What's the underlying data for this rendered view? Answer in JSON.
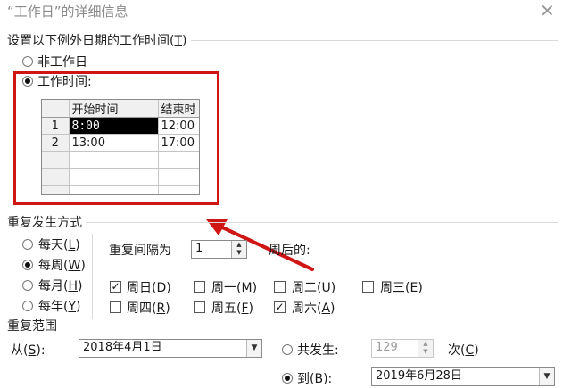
{
  "window": {
    "title": "“工作日”的详细信息",
    "close_label": "✕"
  },
  "worktime_section": {
    "label": "设置以下例外日期的工作时间(",
    "label_key": "T",
    "label_end": ")",
    "nonworking_label": "非工作日",
    "working_label": "工作时间:",
    "nonworking_selected": false,
    "working_selected": true
  },
  "time_grid": {
    "columns": [
      "开始时间",
      "结束时"
    ],
    "rows": [
      {
        "num": "1",
        "start": "8:00",
        "end": "12:00"
      },
      {
        "num": "2",
        "start": "13:00",
        "end": "17:00"
      },
      {
        "num": "",
        "start": "",
        "end": ""
      },
      {
        "num": "",
        "start": "",
        "end": ""
      },
      {
        "num": "",
        "start": "",
        "end": ""
      }
    ]
  },
  "recurrence_pattern": {
    "label": "重复发生方式",
    "options": [
      {
        "text": "每天(",
        "key": "L",
        "selected": false
      },
      {
        "text": "每周(",
        "key": "W",
        "selected": true
      },
      {
        "text": "每月(",
        "key": "H",
        "selected": false
      },
      {
        "text": "每年(",
        "key": "Y",
        "selected": false
      }
    ],
    "interval_label": "重复间隔为",
    "interval_value": "1",
    "weeks_after_label": "周后的:",
    "days": [
      {
        "text": "周日(",
        "key": "D",
        "checked": true
      },
      {
        "text": "周一(",
        "key": "M",
        "checked": false
      },
      {
        "text": "周二(",
        "key": "U",
        "checked": false
      },
      {
        "text": "周三(",
        "key": "E",
        "checked": false
      },
      {
        "text": "周四(",
        "key": "R",
        "checked": false
      },
      {
        "text": "周五(",
        "key": "F",
        "checked": false
      },
      {
        "text": "周六(",
        "key": "A",
        "checked": true
      }
    ]
  },
  "recurrence_range": {
    "label": "重复范围",
    "from_label": "从(",
    "from_key": "S",
    "from_end": "):",
    "from_value": "2018年4月1日",
    "occur_label": "共发生:",
    "occur_value": "129",
    "occur_unit": "次(",
    "occur_key": "C",
    "to_label": "到(",
    "to_key": "B",
    "to_end": "):",
    "to_value": "2019年6月28日",
    "occur_selected": false,
    "to_selected": true
  },
  "colors": {
    "highlight": "#d01515",
    "arrow": "#d01515"
  }
}
